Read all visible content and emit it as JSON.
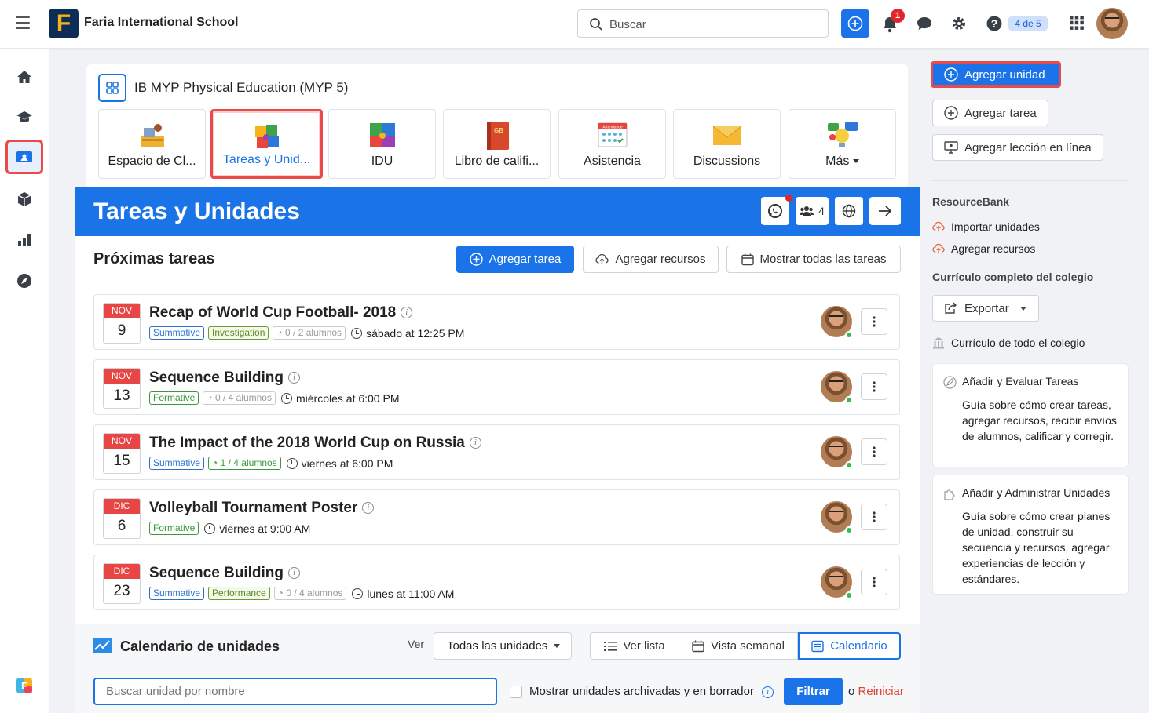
{
  "header": {
    "logo_letter": "F",
    "school_name": "Faria International School",
    "search_placeholder": "Buscar",
    "notifications_count": "1",
    "pager": "4 de 5"
  },
  "course": {
    "title": "IB MYP Physical Education (MYP 5)",
    "tabs": [
      {
        "label": "Espacio de Cl...",
        "icon": "classroom-icon"
      },
      {
        "label": "Tareas y Unid...",
        "icon": "puzzle-icon",
        "active": true
      },
      {
        "label": "IDU",
        "icon": "idu-puzzle-icon"
      },
      {
        "label": "Libro de califi...",
        "icon": "gradebook-icon",
        "badge": "GB"
      },
      {
        "label": "Asistencia",
        "icon": "attendance-icon",
        "badge": "Attendance"
      },
      {
        "label": "Discussions",
        "icon": "envelope-icon"
      },
      {
        "label": "Más",
        "icon": "lightbulb-chat-icon"
      }
    ]
  },
  "page": {
    "title": "Tareas y Unidades",
    "members_count": "4"
  },
  "upcoming": {
    "title": "Próximas tareas",
    "add_task": "Agregar tarea",
    "add_resources": "Agregar recursos",
    "show_all": "Mostrar todas las tareas",
    "tasks": [
      {
        "month": "NOV",
        "day": "9",
        "name": "Recap of World Cup Football- 2018",
        "tags": [
          "Summative",
          "Investigation"
        ],
        "students": "0 / 2 alumnos",
        "when": "sábado at 12:25 PM"
      },
      {
        "month": "NOV",
        "day": "13",
        "name": "Sequence Building",
        "tags": [
          "Formative"
        ],
        "students": "0 / 4 alumnos",
        "when": "miércoles at 6:00 PM"
      },
      {
        "month": "NOV",
        "day": "15",
        "name": "The Impact of the 2018 World Cup on Russia",
        "tags": [
          "Summative"
        ],
        "students": "1 / 4 alumnos",
        "when": "viernes at 6:00 PM"
      },
      {
        "month": "DIC",
        "day": "6",
        "name": "Volleyball Tournament Poster",
        "tags": [
          "Formative"
        ],
        "students": "",
        "when": "viernes at 9:00 AM"
      },
      {
        "month": "DIC",
        "day": "23",
        "name": "Sequence Building",
        "tags": [
          "Summative",
          "Performance"
        ],
        "students": "0 / 4 alumnos",
        "when": "lunes at 11:00 AM"
      }
    ]
  },
  "calendar": {
    "title": "Calendario de unidades",
    "ver_label": "Ver",
    "filter_value": "Todas las unidades",
    "view_list": "Ver lista",
    "view_week": "Vista semanal",
    "view_calendar": "Calendario",
    "search_placeholder": "Buscar unidad por nombre",
    "show_archived": "Mostrar unidades archivadas y en borrador",
    "filter_btn": "Filtrar",
    "or": "o",
    "reset": "Reiniciar"
  },
  "right": {
    "add_unit": "Agregar unidad",
    "add_task": "Agregar tarea",
    "add_online_lesson": "Agregar lección en línea",
    "resourcebank": "ResourceBank",
    "import_units": "Importar unidades",
    "add_resources": "Agregar recursos",
    "curriculum_title": "Currículo completo del colegio",
    "export": "Exportar",
    "school_curriculum": "Currículo de todo el colegio",
    "guide1_title": "Añadir y Evaluar Tareas",
    "guide1_desc": "Guía sobre cómo crear tareas, agregar recursos, recibir envíos de alumnos, calificar y corregir.",
    "guide2_title": "Añadir y Administrar Unidades",
    "guide2_desc": "Guía sobre cómo crear planes de unidad, construir su secuencia y recursos, agregar experiencias de lección y estándares."
  },
  "colors": {
    "accent": "#1a73e8",
    "highlight": "#ea4a4a",
    "date_red": "#e84545"
  }
}
